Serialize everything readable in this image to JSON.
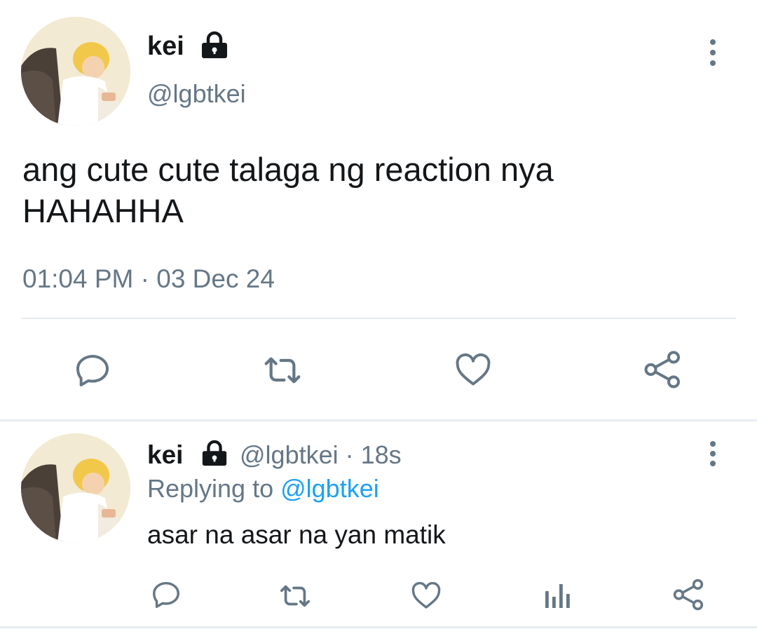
{
  "tweet": {
    "author": {
      "name": "kei",
      "handle": "@lgbtkei",
      "protected_icon": "lock-icon",
      "avatar": "profile-photo"
    },
    "text_line1": "ang cute cute talaga ng reaction nya",
    "text_line2": "HAHAHHA",
    "timestamp": "01:04 PM · 03 Dec 24",
    "actions": [
      "reply-icon",
      "retweet-icon",
      "like-icon",
      "share-icon"
    ]
  },
  "reply": {
    "author": {
      "name": "kei",
      "handle": "@lgbtkei",
      "protected_icon": "lock-icon"
    },
    "meta": " · 18s",
    "replying_prefix": "Replying to ",
    "replying_to": "@lgbtkei",
    "text": "asar na asar na yan matik",
    "actions": [
      "reply-icon",
      "retweet-icon",
      "like-icon",
      "analytics-icon",
      "share-icon"
    ]
  },
  "colors": {
    "text": "#14171a",
    "muted": "#657786",
    "link": "#1da1f2",
    "divider": "#e6ecf0",
    "background": "#ffffff"
  }
}
